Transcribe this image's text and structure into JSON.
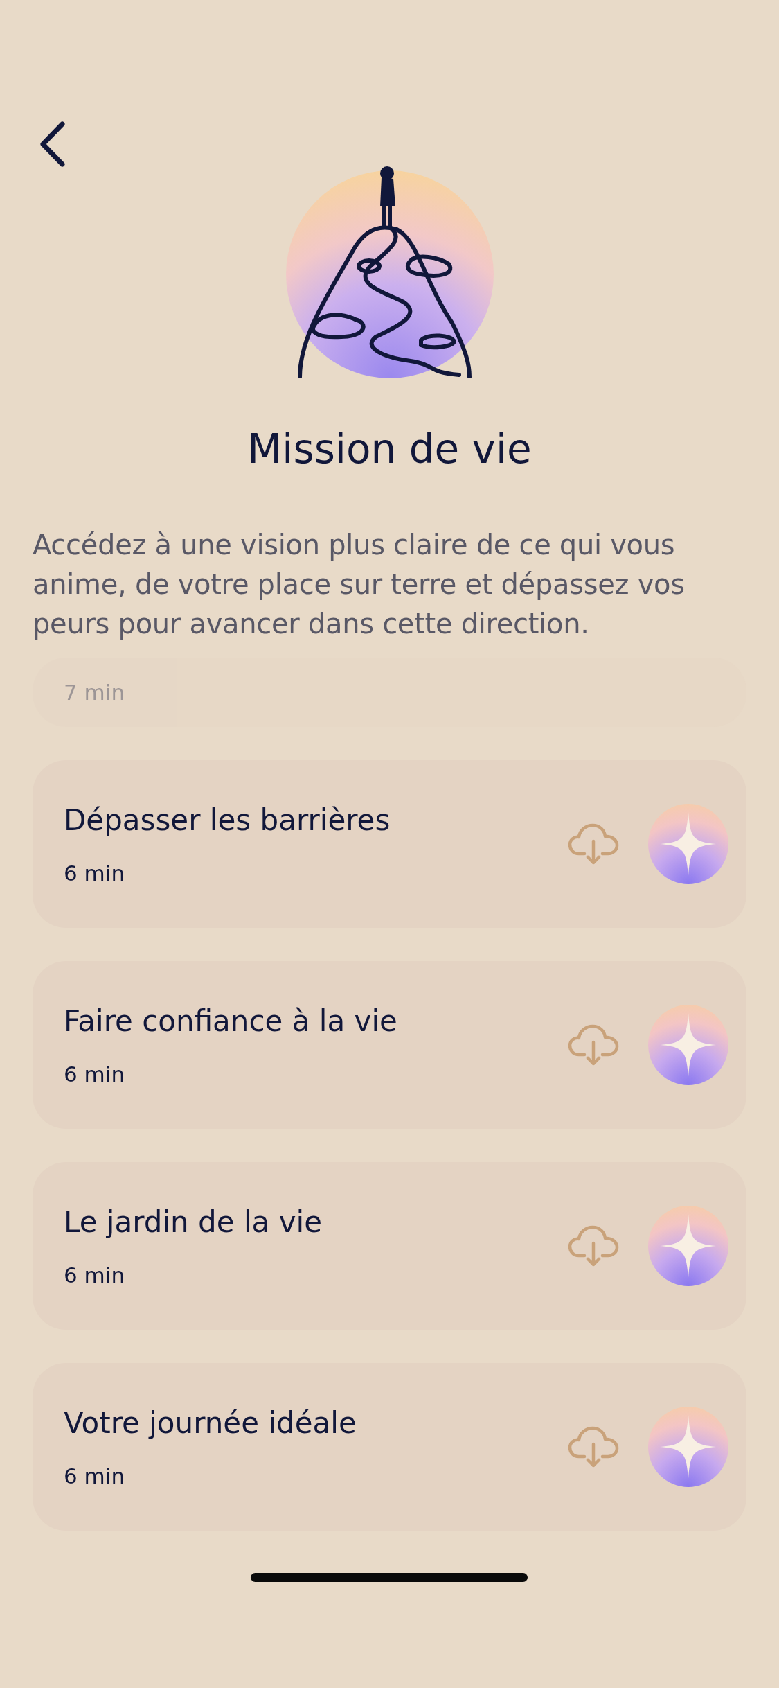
{
  "title": "Mission de vie",
  "description": "Accédez à une vision plus claire de ce qui vous anime, de votre place sur terre et dépassez vos peurs pour avancer dans cette direction.",
  "sessions": [
    {
      "kind": "faded",
      "duration": "7 min"
    },
    {
      "kind": "full",
      "title": "Dépasser les barrières",
      "duration": "6 min"
    },
    {
      "kind": "full",
      "title": "Faire confiance à la vie",
      "duration": "6 min"
    },
    {
      "kind": "full",
      "title": "Le jardin de la vie",
      "duration": "6 min"
    },
    {
      "kind": "full",
      "title": "Votre journée idéale",
      "duration": "6 min"
    }
  ]
}
